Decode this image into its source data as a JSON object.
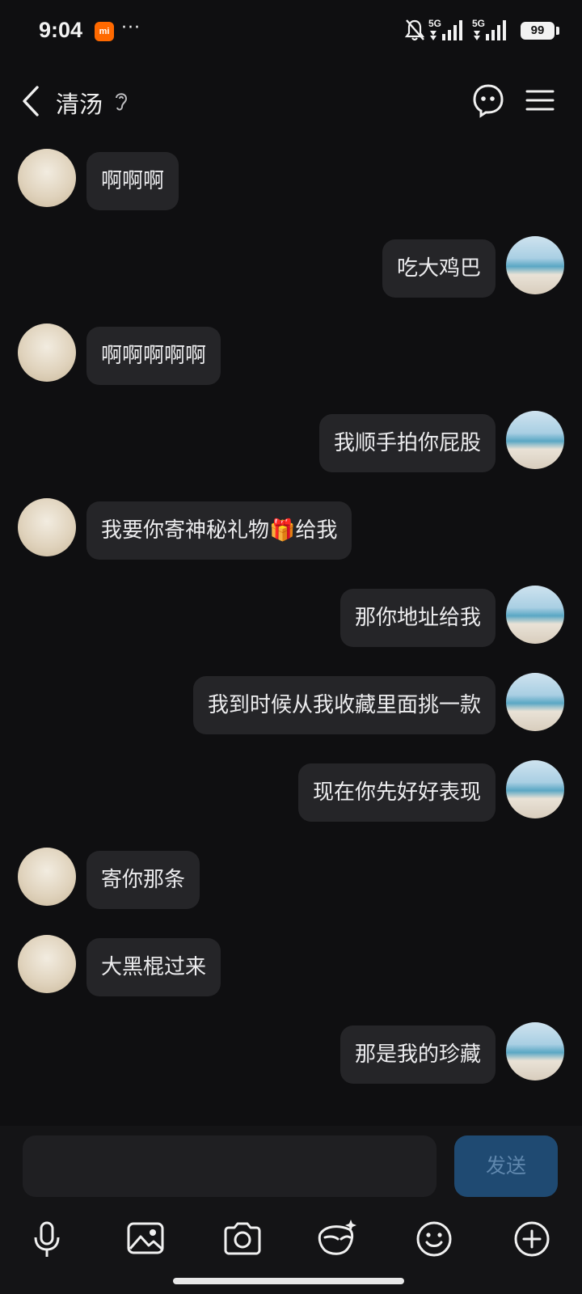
{
  "status_bar": {
    "time": "9:04",
    "mi_badge": "mi",
    "more": "···",
    "signal1": "5G",
    "signal2": "5G",
    "battery": "99"
  },
  "header": {
    "title": "清汤"
  },
  "messages": [
    {
      "side": "left",
      "text": "啊啊啊"
    },
    {
      "side": "right",
      "text": "吃大鸡巴"
    },
    {
      "side": "left",
      "text": "啊啊啊啊啊"
    },
    {
      "side": "right",
      "text": "我顺手拍你屁股"
    },
    {
      "side": "left",
      "text": "我要你寄神秘礼物🎁给我"
    },
    {
      "side": "right",
      "text": "那你地址给我"
    },
    {
      "side": "right",
      "text": "我到时候从我收藏里面挑一款"
    },
    {
      "side": "right",
      "text": "现在你先好好表现"
    },
    {
      "side": "left",
      "text": "寄你那条"
    },
    {
      "side": "left",
      "text": "大黑棍过来"
    },
    {
      "side": "right",
      "text": "那是我的珍藏"
    }
  ],
  "composer": {
    "input_value": "",
    "send_label": "发送"
  },
  "toolbar": {
    "icons": [
      "microphone-icon",
      "image-icon",
      "camera-icon",
      "ai-face-icon",
      "emoji-icon",
      "plus-icon"
    ]
  },
  "colors": {
    "background": "#0f0f11",
    "bubble": "#252528",
    "send_button": "#1f4a72",
    "mi_badge": "#ff6900"
  }
}
